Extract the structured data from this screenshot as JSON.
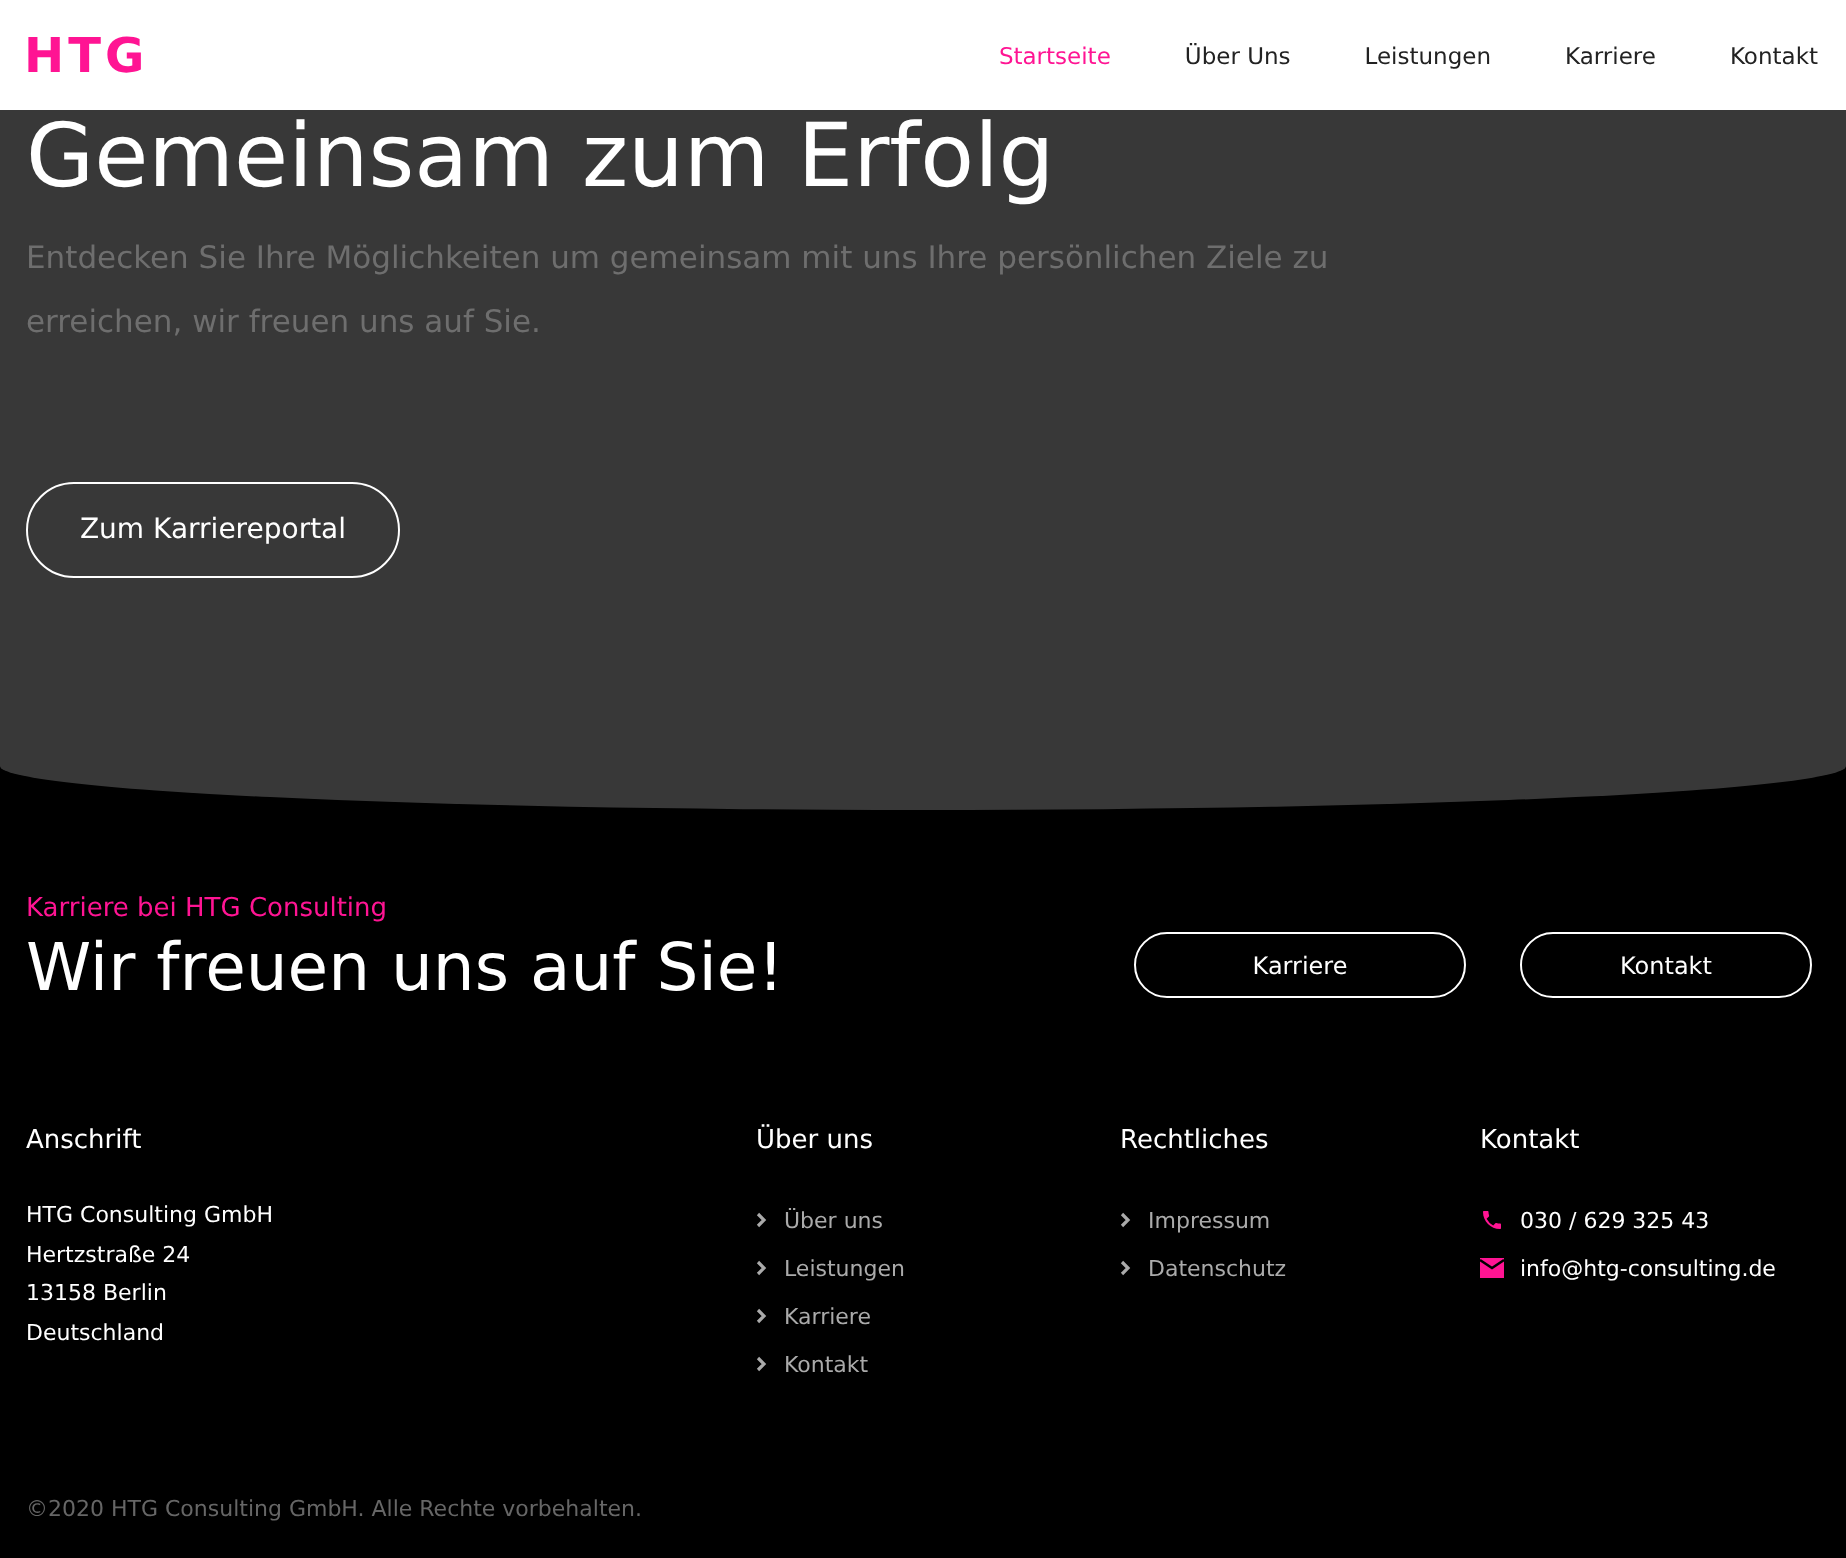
{
  "header": {
    "logo": "HTG",
    "nav": [
      {
        "label": "Startseite",
        "selected": true
      },
      {
        "label": "Über Uns",
        "selected": false
      },
      {
        "label": "Leistungen",
        "selected": false
      },
      {
        "label": "Karriere",
        "selected": false
      },
      {
        "label": "Kontakt",
        "selected": false
      }
    ]
  },
  "hero": {
    "title": "Gemeinsam zum Erfolg",
    "text": "Entdecken Sie Ihre Möglichkeiten um gemeinsam mit uns Ihre persönlichen Ziele zu erreichen, wir freuen uns auf Sie.",
    "button": "Zum Karriereportal"
  },
  "cta": {
    "kicker": "Karriere bei HTG Consulting",
    "title": "Wir freuen uns auf Sie!",
    "buttons": [
      "Karriere",
      "Kontakt"
    ]
  },
  "footer": {
    "columns": [
      {
        "kind": "address",
        "title": "Anschrift",
        "lines": [
          "HTG Consulting GmbH",
          "Hertzstraße 24",
          "13158 Berlin",
          "Deutschland"
        ]
      },
      {
        "kind": "links",
        "title": "Über uns",
        "lines": [
          "Über uns",
          "Leistungen",
          "Karriere",
          "Kontakt"
        ]
      },
      {
        "kind": "links",
        "title": "Rechtliches",
        "lines": [
          "Impressum",
          "Datenschutz"
        ]
      },
      {
        "kind": "contact",
        "title": "Kontakt",
        "lines": [
          "030 / 629 325 43",
          "info@htg-consulting.de"
        ]
      }
    ],
    "copyright": "©2020 HTG Consulting GmbH. Alle Rechte vorbehalten."
  }
}
